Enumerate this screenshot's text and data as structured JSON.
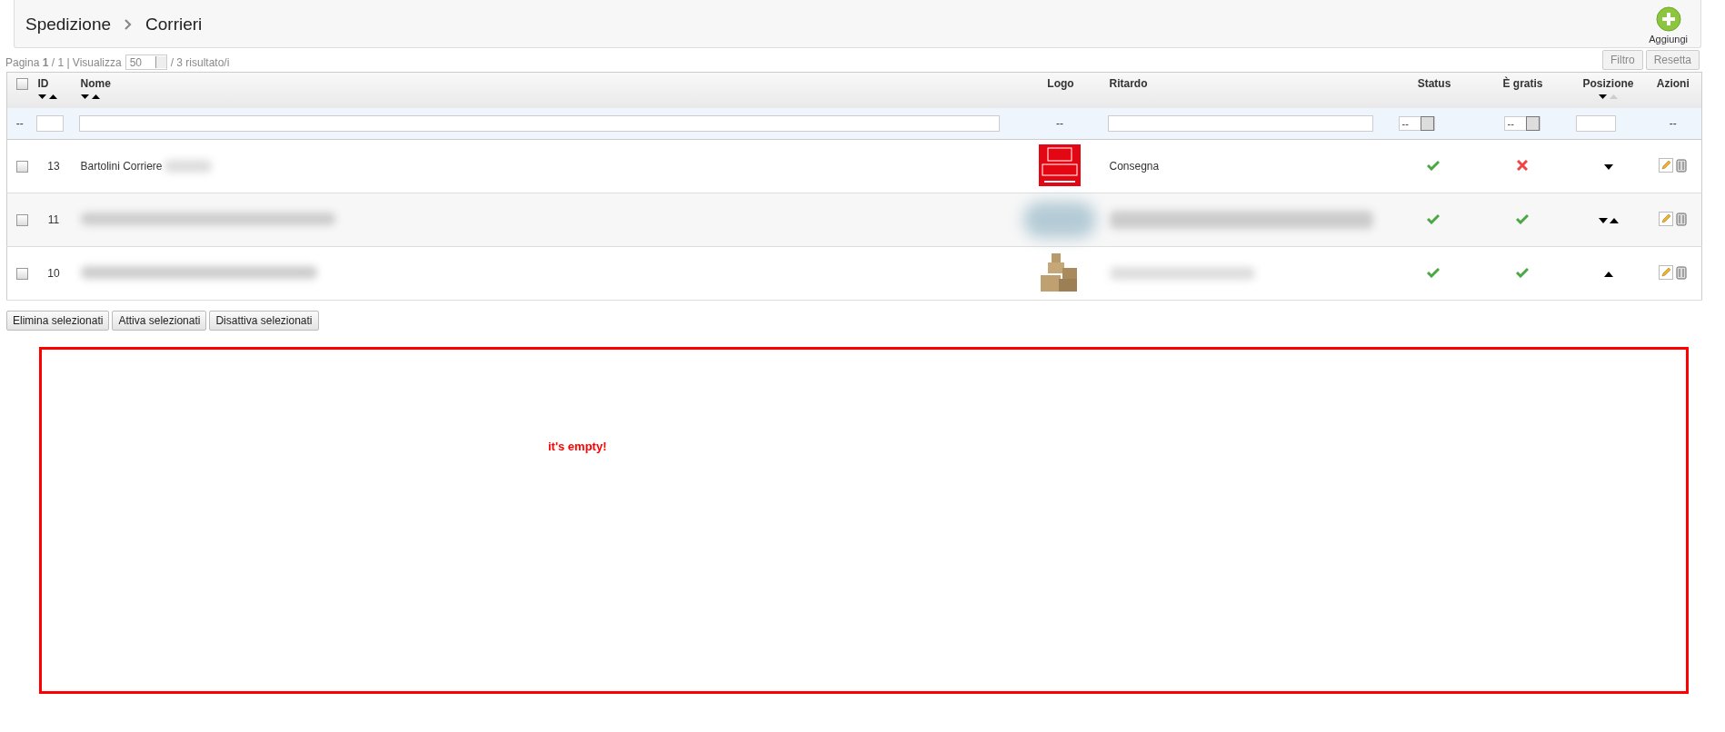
{
  "toolbar": {
    "breadcrumb": [
      "Spedizione",
      "Corrieri"
    ],
    "add_label": "Aggiungi"
  },
  "pager": {
    "page_label": "Pagina",
    "page": "1",
    "of": "/ 1 |",
    "show_label": "Visualizza",
    "per_page": "50",
    "results": "/ 3 risultato/i"
  },
  "filter_buttons": [
    "Filtro",
    "Resetta"
  ],
  "table": {
    "select_all_checked": false,
    "columns": [
      {
        "label": "ID",
        "sort_arrows": {
          "down_active": true,
          "up_active": true
        }
      },
      {
        "label": "Nome",
        "sort_arrows": {
          "down_active": true,
          "up_active": true
        }
      },
      {
        "label": "Logo"
      },
      {
        "label": "Ritardo"
      },
      {
        "label": "Status"
      },
      {
        "label": "È gratis"
      },
      {
        "label": "Posizione",
        "sort_arrows": {
          "down_active": true,
          "up_active": false
        }
      },
      {
        "label": "Azioni"
      }
    ],
    "filters": {
      "placeholder_dash": "--",
      "status_select": "--",
      "free_select": "--",
      "actions_dash": "--"
    },
    "rows": [
      {
        "checked": false,
        "id": "13",
        "name": "Bartolini Corriere",
        "name_blurred": true,
        "logo": {
          "kind": "brt"
        },
        "delay": "Consegna",
        "delay_blurred": false,
        "status": true,
        "free": false,
        "move_down": true,
        "move_up": false
      },
      {
        "checked": false,
        "id": "11",
        "name_blurred": true,
        "logo": {
          "kind": "blurred"
        },
        "delay_blurred": true,
        "status": true,
        "free": true,
        "move_down": true,
        "move_up": true
      },
      {
        "checked": false,
        "id": "10",
        "name_blurred": true,
        "logo": {
          "kind": "boxes"
        },
        "delay_blurred": true,
        "status": true,
        "free": true,
        "move_down": false,
        "move_up": true
      }
    ]
  },
  "bulk_buttons": [
    "Elimina selezionati",
    "Attiva selezionati",
    "Disattiva selezionati"
  ],
  "notice": {
    "text": "it's empty!"
  }
}
